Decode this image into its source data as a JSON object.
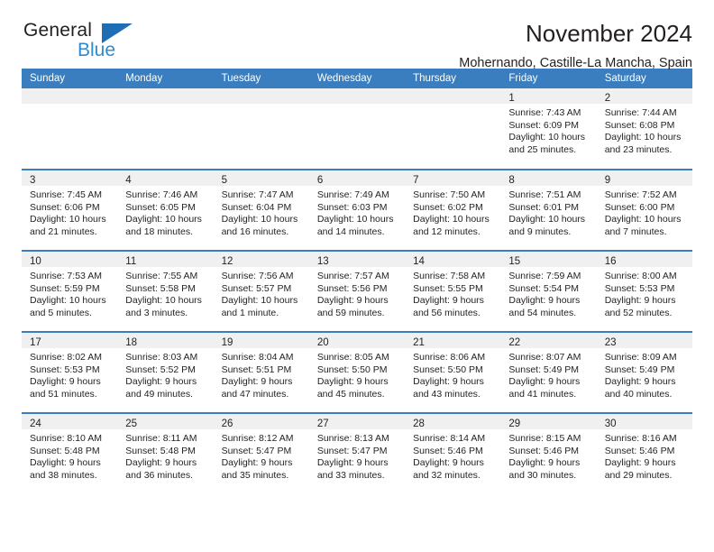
{
  "brand": {
    "name_part1": "General",
    "name_part2": "Blue",
    "triangle_color": "#1f6eb5",
    "blue_text_color": "#2e8bd0"
  },
  "header": {
    "title": "November 2024",
    "subtitle": "Mohernando, Castille-La Mancha, Spain"
  },
  "theme": {
    "header_bg": "#3a7ebf",
    "row_divider": "#3a7ebf",
    "day_band_bg": "#f0f0f0",
    "text": "#231f20"
  },
  "weekdays": [
    "Sunday",
    "Monday",
    "Tuesday",
    "Wednesday",
    "Thursday",
    "Friday",
    "Saturday"
  ],
  "weeks": [
    [
      {
        "day": "",
        "sunrise": "",
        "sunset": "",
        "daylight": "",
        "empty": true
      },
      {
        "day": "",
        "sunrise": "",
        "sunset": "",
        "daylight": "",
        "empty": true
      },
      {
        "day": "",
        "sunrise": "",
        "sunset": "",
        "daylight": "",
        "empty": true
      },
      {
        "day": "",
        "sunrise": "",
        "sunset": "",
        "daylight": "",
        "empty": true
      },
      {
        "day": "",
        "sunrise": "",
        "sunset": "",
        "daylight": "",
        "empty": true
      },
      {
        "day": "1",
        "sunrise": "Sunrise: 7:43 AM",
        "sunset": "Sunset: 6:09 PM",
        "daylight": "Daylight: 10 hours and 25 minutes."
      },
      {
        "day": "2",
        "sunrise": "Sunrise: 7:44 AM",
        "sunset": "Sunset: 6:08 PM",
        "daylight": "Daylight: 10 hours and 23 minutes."
      }
    ],
    [
      {
        "day": "3",
        "sunrise": "Sunrise: 7:45 AM",
        "sunset": "Sunset: 6:06 PM",
        "daylight": "Daylight: 10 hours and 21 minutes."
      },
      {
        "day": "4",
        "sunrise": "Sunrise: 7:46 AM",
        "sunset": "Sunset: 6:05 PM",
        "daylight": "Daylight: 10 hours and 18 minutes."
      },
      {
        "day": "5",
        "sunrise": "Sunrise: 7:47 AM",
        "sunset": "Sunset: 6:04 PM",
        "daylight": "Daylight: 10 hours and 16 minutes."
      },
      {
        "day": "6",
        "sunrise": "Sunrise: 7:49 AM",
        "sunset": "Sunset: 6:03 PM",
        "daylight": "Daylight: 10 hours and 14 minutes."
      },
      {
        "day": "7",
        "sunrise": "Sunrise: 7:50 AM",
        "sunset": "Sunset: 6:02 PM",
        "daylight": "Daylight: 10 hours and 12 minutes."
      },
      {
        "day": "8",
        "sunrise": "Sunrise: 7:51 AM",
        "sunset": "Sunset: 6:01 PM",
        "daylight": "Daylight: 10 hours and 9 minutes."
      },
      {
        "day": "9",
        "sunrise": "Sunrise: 7:52 AM",
        "sunset": "Sunset: 6:00 PM",
        "daylight": "Daylight: 10 hours and 7 minutes."
      }
    ],
    [
      {
        "day": "10",
        "sunrise": "Sunrise: 7:53 AM",
        "sunset": "Sunset: 5:59 PM",
        "daylight": "Daylight: 10 hours and 5 minutes."
      },
      {
        "day": "11",
        "sunrise": "Sunrise: 7:55 AM",
        "sunset": "Sunset: 5:58 PM",
        "daylight": "Daylight: 10 hours and 3 minutes."
      },
      {
        "day": "12",
        "sunrise": "Sunrise: 7:56 AM",
        "sunset": "Sunset: 5:57 PM",
        "daylight": "Daylight: 10 hours and 1 minute."
      },
      {
        "day": "13",
        "sunrise": "Sunrise: 7:57 AM",
        "sunset": "Sunset: 5:56 PM",
        "daylight": "Daylight: 9 hours and 59 minutes."
      },
      {
        "day": "14",
        "sunrise": "Sunrise: 7:58 AM",
        "sunset": "Sunset: 5:55 PM",
        "daylight": "Daylight: 9 hours and 56 minutes."
      },
      {
        "day": "15",
        "sunrise": "Sunrise: 7:59 AM",
        "sunset": "Sunset: 5:54 PM",
        "daylight": "Daylight: 9 hours and 54 minutes."
      },
      {
        "day": "16",
        "sunrise": "Sunrise: 8:00 AM",
        "sunset": "Sunset: 5:53 PM",
        "daylight": "Daylight: 9 hours and 52 minutes."
      }
    ],
    [
      {
        "day": "17",
        "sunrise": "Sunrise: 8:02 AM",
        "sunset": "Sunset: 5:53 PM",
        "daylight": "Daylight: 9 hours and 51 minutes."
      },
      {
        "day": "18",
        "sunrise": "Sunrise: 8:03 AM",
        "sunset": "Sunset: 5:52 PM",
        "daylight": "Daylight: 9 hours and 49 minutes."
      },
      {
        "day": "19",
        "sunrise": "Sunrise: 8:04 AM",
        "sunset": "Sunset: 5:51 PM",
        "daylight": "Daylight: 9 hours and 47 minutes."
      },
      {
        "day": "20",
        "sunrise": "Sunrise: 8:05 AM",
        "sunset": "Sunset: 5:50 PM",
        "daylight": "Daylight: 9 hours and 45 minutes."
      },
      {
        "day": "21",
        "sunrise": "Sunrise: 8:06 AM",
        "sunset": "Sunset: 5:50 PM",
        "daylight": "Daylight: 9 hours and 43 minutes."
      },
      {
        "day": "22",
        "sunrise": "Sunrise: 8:07 AM",
        "sunset": "Sunset: 5:49 PM",
        "daylight": "Daylight: 9 hours and 41 minutes."
      },
      {
        "day": "23",
        "sunrise": "Sunrise: 8:09 AM",
        "sunset": "Sunset: 5:49 PM",
        "daylight": "Daylight: 9 hours and 40 minutes."
      }
    ],
    [
      {
        "day": "24",
        "sunrise": "Sunrise: 8:10 AM",
        "sunset": "Sunset: 5:48 PM",
        "daylight": "Daylight: 9 hours and 38 minutes."
      },
      {
        "day": "25",
        "sunrise": "Sunrise: 8:11 AM",
        "sunset": "Sunset: 5:48 PM",
        "daylight": "Daylight: 9 hours and 36 minutes."
      },
      {
        "day": "26",
        "sunrise": "Sunrise: 8:12 AM",
        "sunset": "Sunset: 5:47 PM",
        "daylight": "Daylight: 9 hours and 35 minutes."
      },
      {
        "day": "27",
        "sunrise": "Sunrise: 8:13 AM",
        "sunset": "Sunset: 5:47 PM",
        "daylight": "Daylight: 9 hours and 33 minutes."
      },
      {
        "day": "28",
        "sunrise": "Sunrise: 8:14 AM",
        "sunset": "Sunset: 5:46 PM",
        "daylight": "Daylight: 9 hours and 32 minutes."
      },
      {
        "day": "29",
        "sunrise": "Sunrise: 8:15 AM",
        "sunset": "Sunset: 5:46 PM",
        "daylight": "Daylight: 9 hours and 30 minutes."
      },
      {
        "day": "30",
        "sunrise": "Sunrise: 8:16 AM",
        "sunset": "Sunset: 5:46 PM",
        "daylight": "Daylight: 9 hours and 29 minutes."
      }
    ]
  ]
}
